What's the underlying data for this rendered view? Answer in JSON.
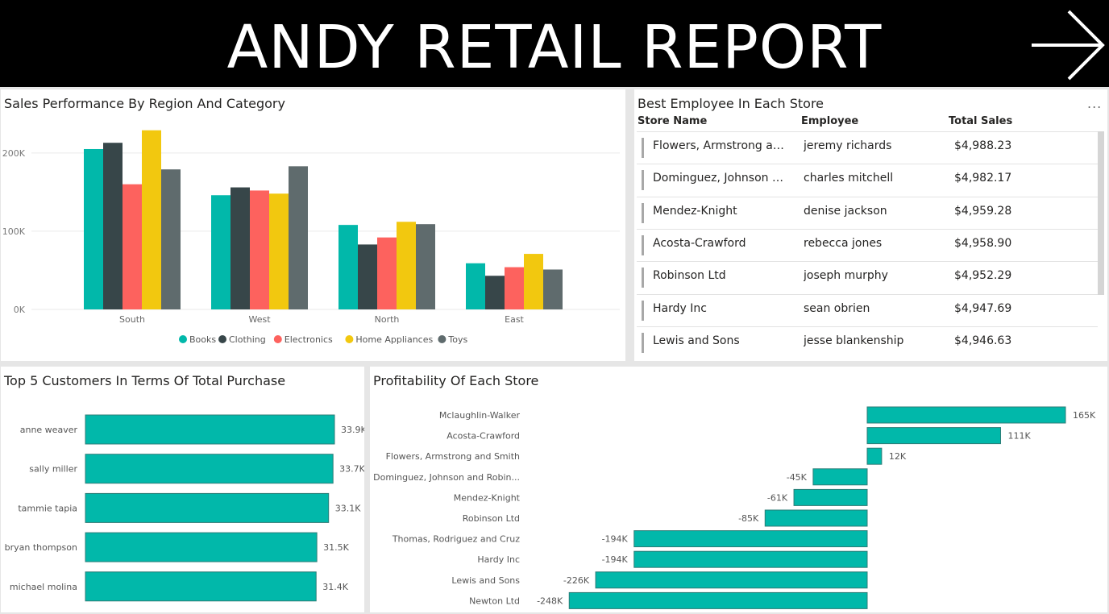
{
  "header": {
    "title": "ANDY RETAIL REPORT",
    "nav_icon": "arrow-right-icon"
  },
  "sales_panel": {
    "title": "Sales Performance By Region And Category"
  },
  "employee_panel": {
    "title": "Best Employee In Each Store",
    "more_label": "...",
    "columns": [
      "Store Name",
      "Employee",
      "Total Sales"
    ],
    "rows": [
      [
        "Flowers, Armstrong and ...",
        "jeremy richards",
        "$4,988.23"
      ],
      [
        "Dominguez, Johnson an...",
        "charles mitchell",
        "$4,982.17"
      ],
      [
        "Mendez-Knight",
        "denise jackson",
        "$4,959.28"
      ],
      [
        "Acosta-Crawford",
        "rebecca jones",
        "$4,958.90"
      ],
      [
        "Robinson Ltd",
        "joseph murphy",
        "$4,952.29"
      ],
      [
        "Hardy Inc",
        "sean obrien",
        "$4,947.69"
      ],
      [
        "Lewis and Sons",
        "jesse blankenship",
        "$4,946.63"
      ]
    ]
  },
  "customers_panel": {
    "title": "Top 5 Customers In Terms Of Total Purchase"
  },
  "profit_panel": {
    "title": "Profitability Of Each Store"
  },
  "colors": {
    "Books": "#01b8aa",
    "Clothing": "#374649",
    "Electronics": "#fd625e",
    "Home Appliances": "#f2c80f",
    "Toys": "#5f6b6d",
    "bar": "#01b8aa"
  },
  "chart_data": [
    {
      "type": "bar",
      "title": "Sales Performance By Region And Category",
      "categories": [
        "South",
        "West",
        "North",
        "East"
      ],
      "series": [
        {
          "name": "Books",
          "values": [
            205000,
            146000,
            108000,
            59000
          ]
        },
        {
          "name": "Clothing",
          "values": [
            213000,
            156000,
            83000,
            43000
          ]
        },
        {
          "name": "Electronics",
          "values": [
            160000,
            152000,
            92000,
            54000
          ]
        },
        {
          "name": "Home Appliances",
          "values": [
            229000,
            148000,
            112000,
            71000
          ]
        },
        {
          "name": "Toys",
          "values": [
            179000,
            183000,
            109000,
            51000
          ]
        }
      ],
      "yticks": [
        "0K",
        "100K",
        "200K"
      ],
      "ylim": [
        0,
        240000
      ],
      "legend": "bottom-center",
      "grid": true
    },
    {
      "type": "bar",
      "orientation": "horizontal",
      "title": "Top 5 Customers In Terms Of Total Purchase",
      "categories": [
        "anne weaver",
        "sally miller",
        "tammie tapia",
        "bryan thompson",
        "michael molina"
      ],
      "values": [
        33900,
        33700,
        33100,
        31500,
        31400
      ],
      "data_labels": [
        "33.9K",
        "33.7K",
        "33.1K",
        "31.5K",
        "31.4K"
      ],
      "xlim": [
        0,
        33900
      ]
    },
    {
      "type": "bar",
      "orientation": "horizontal",
      "title": "Profitability Of Each Store",
      "categories": [
        "Mclaughlin-Walker",
        "Acosta-Crawford",
        "Flowers, Armstrong and Smith",
        "Dominguez, Johnson and Robin...",
        "Mendez-Knight",
        "Robinson Ltd",
        "Thomas, Rodriguez and Cruz",
        "Hardy Inc",
        "Lewis and Sons",
        "Newton Ltd"
      ],
      "values": [
        165000,
        111000,
        12000,
        -45000,
        -61000,
        -85000,
        -194000,
        -194000,
        -226000,
        -248000
      ],
      "data_labels": [
        "165K",
        "111K",
        "12K",
        "-45K",
        "-61K",
        "-85K",
        "-194K",
        "-194K",
        "-226K",
        "-248K"
      ],
      "xlim": [
        -248000,
        165000
      ]
    }
  ]
}
